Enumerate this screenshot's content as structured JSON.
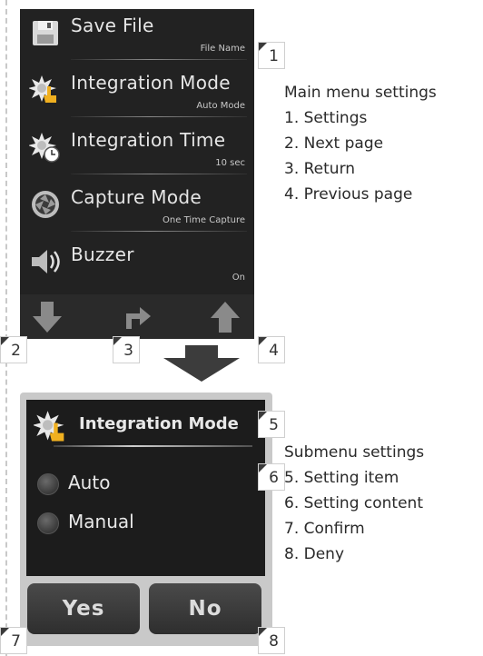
{
  "main_menu": {
    "items": [
      {
        "title": "Save File",
        "value": "File Name",
        "icon": "floppy-disk-icon"
      },
      {
        "title": "Integration Mode",
        "value": "Auto Mode",
        "icon": "starburst-hand-icon"
      },
      {
        "title": "Integration Time",
        "value": "10 sec",
        "icon": "starburst-clock-icon"
      },
      {
        "title": "Capture Mode",
        "value": "One Time Capture",
        "icon": "aperture-icon"
      },
      {
        "title": "Buzzer",
        "value": "On",
        "icon": "speaker-icon"
      }
    ],
    "nav": [
      {
        "icon": "arrow-down-icon"
      },
      {
        "icon": "return-arrow-icon"
      },
      {
        "icon": "arrow-up-icon"
      }
    ]
  },
  "callouts": [
    "1",
    "2",
    "3",
    "4",
    "5",
    "6",
    "7",
    "8"
  ],
  "main_desc": {
    "heading": "Main menu settings",
    "lines": [
      "1. Settings",
      "2. Next page",
      "3. Return",
      "4. Previous page"
    ]
  },
  "submenu": {
    "title": "Integration Mode",
    "title_icon": "starburst-hand-icon",
    "options": [
      "Auto",
      "Manual"
    ],
    "yes_label": "Yes",
    "no_label": "No"
  },
  "sub_desc": {
    "heading": "Submenu settings",
    "lines": [
      "5. Setting item",
      "6. Setting content",
      "7. Confirm",
      "8. Deny"
    ]
  },
  "colors": {
    "screen_bg": "#222222",
    "frame": "#c9c9c9",
    "arrow": "#3c3c3c"
  }
}
